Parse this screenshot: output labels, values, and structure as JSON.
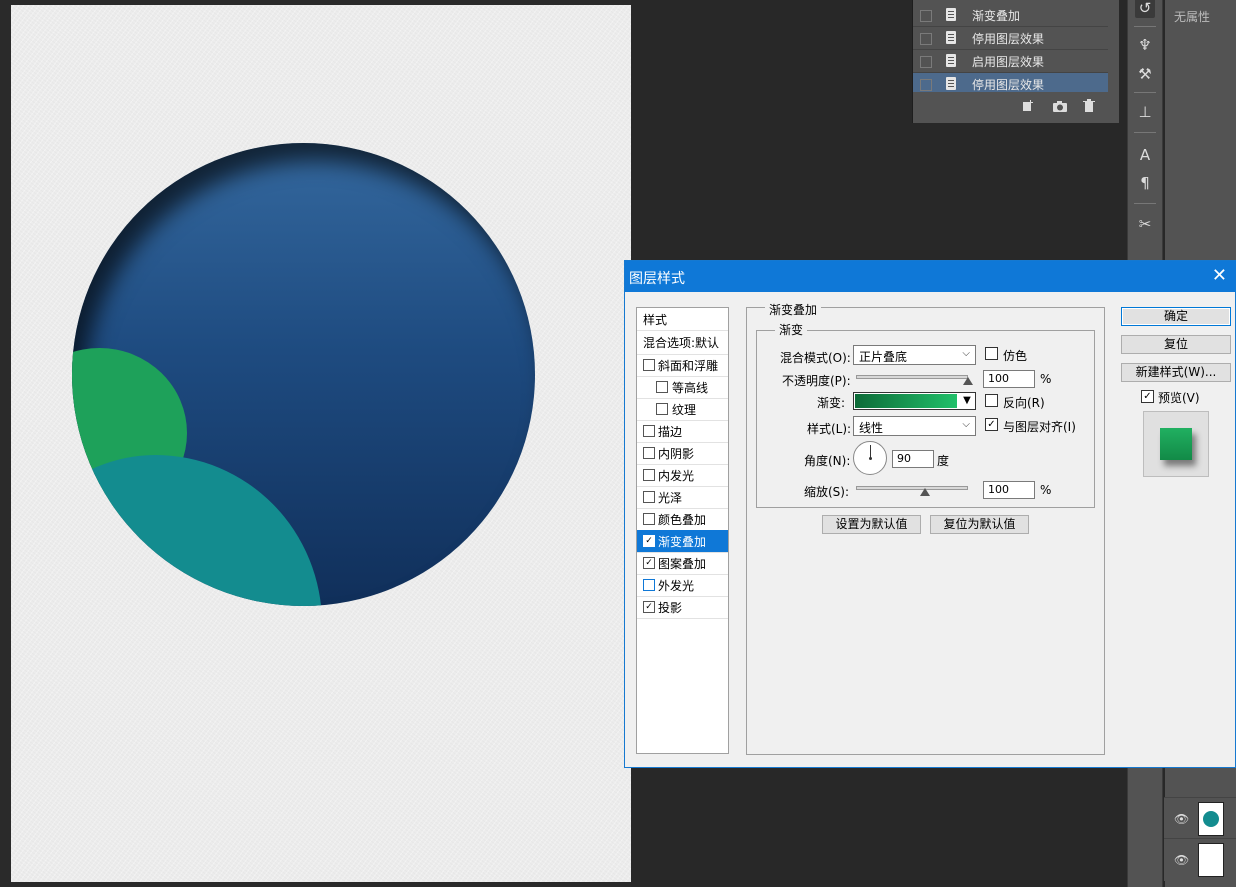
{
  "history": {
    "items": [
      {
        "label": "渐变叠加"
      },
      {
        "label": "停用图层效果"
      },
      {
        "label": "启用图层效果"
      },
      {
        "label": "停用图层效果"
      }
    ]
  },
  "properties": {
    "label": "无属性"
  },
  "dialog": {
    "title": "图层样式",
    "close_icon": "✕",
    "style_list": [
      {
        "label": "样式",
        "checkbox": false,
        "checked": false
      },
      {
        "label": "混合选项:默认",
        "checkbox": false,
        "checked": false
      },
      {
        "label": "斜面和浮雕",
        "checkbox": true,
        "checked": false
      },
      {
        "label": "等高线",
        "checkbox": true,
        "checked": false,
        "indent": true
      },
      {
        "label": "纹理",
        "checkbox": true,
        "checked": false,
        "indent": true
      },
      {
        "label": "描边",
        "checkbox": true,
        "checked": false
      },
      {
        "label": "内阴影",
        "checkbox": true,
        "checked": false
      },
      {
        "label": "内发光",
        "checkbox": true,
        "checked": false
      },
      {
        "label": "光泽",
        "checkbox": true,
        "checked": false
      },
      {
        "label": "颜色叠加",
        "checkbox": true,
        "checked": false
      },
      {
        "label": "渐变叠加",
        "checkbox": true,
        "checked": true,
        "selected": true
      },
      {
        "label": "图案叠加",
        "checkbox": true,
        "checked": true
      },
      {
        "label": "外发光",
        "checkbox": true,
        "checked": false
      },
      {
        "label": "投影",
        "checkbox": true,
        "checked": true
      }
    ],
    "section_title": "渐变叠加",
    "group_title": "渐变",
    "blend_mode": {
      "label": "混合模式(O):",
      "value": "正片叠底"
    },
    "dither": {
      "label": "仿色",
      "checked": false
    },
    "opacity": {
      "label": "不透明度(P):",
      "value": "100",
      "unit": "%",
      "level": 1.0
    },
    "gradient": {
      "label": "渐变:",
      "start_color": "#0d6b38",
      "end_color": "#21c06a"
    },
    "reverse": {
      "label": "反向(R)",
      "checked": false
    },
    "style": {
      "label": "样式(L):",
      "value": "线性"
    },
    "align_layer": {
      "label": "与图层对齐(I)",
      "checked": true
    },
    "angle": {
      "label": "角度(N):",
      "value": "90",
      "unit": "度"
    },
    "scale": {
      "label": "缩放(S):",
      "value": "100",
      "unit": "%",
      "level": 0.6
    },
    "set_default": "设置为默认值",
    "reset_default": "复位为默认值",
    "ok": "确定",
    "reset": "复位",
    "new_style": "新建样式(W)...",
    "preview": {
      "label": "预览(V)",
      "checked": true
    }
  },
  "colors": {
    "accent": "#0f78d7",
    "circle_top": "#34689e",
    "circle_bottom": "#102f5a",
    "leaf_green": "#1ea15a",
    "leaf_teal": "#138c8f"
  }
}
